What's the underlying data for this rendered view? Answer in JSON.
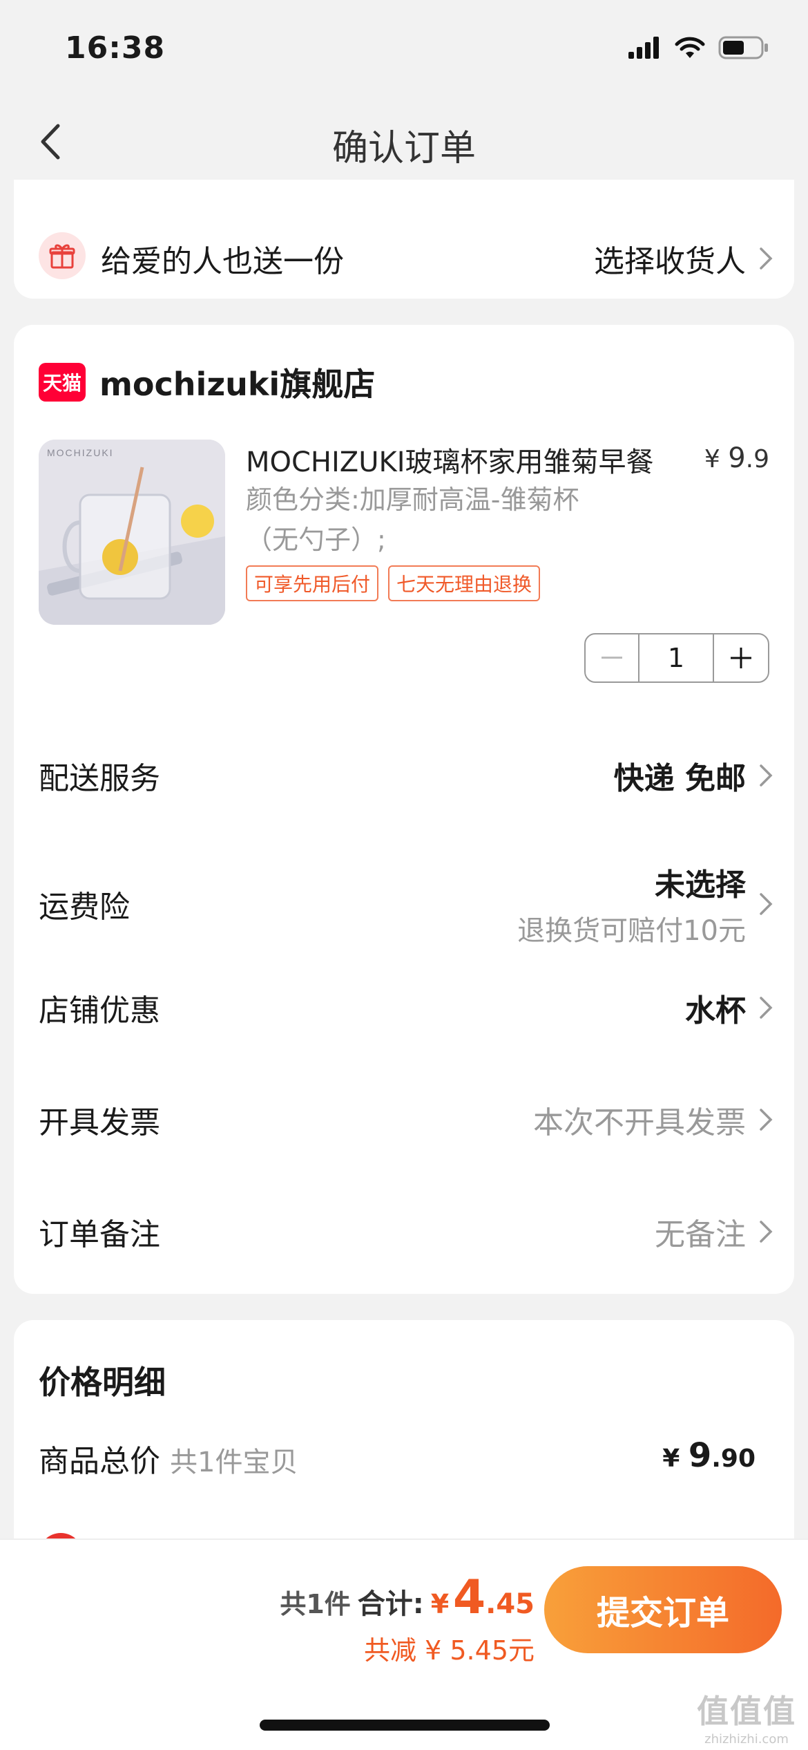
{
  "status_bar": {
    "time": "16:38"
  },
  "nav": {
    "title": "确认订单"
  },
  "gift": {
    "label": "给爱的人也送一份",
    "action": "选择收货人"
  },
  "shop": {
    "logo_text": "天猫",
    "name": "mochizuki旗舰店"
  },
  "product": {
    "image_brand": "MOCHIZUKI",
    "title": "MOCHIZUKI玻璃杯家用雏菊早餐",
    "price_symbol": "¥",
    "price_int": "9",
    "price_dec": ".9",
    "spec_line1": "颜色分类:加厚耐高温-雏菊杯",
    "spec_line2": "（无勺子）;",
    "tags": [
      "可享先用后付",
      "七天无理由退换"
    ],
    "quantity": "1"
  },
  "rows": {
    "delivery": {
      "label": "配送服务",
      "value": "快递 免邮"
    },
    "insurance": {
      "label": "运费险",
      "value": "未选择",
      "sub": "退换货可赔付10元"
    },
    "shop_discount": {
      "label": "店铺优惠",
      "value": "水杯"
    },
    "invoice": {
      "label": "开具发票",
      "value": "本次不开具发票"
    },
    "note": {
      "label": "订单备注",
      "value": "无备注"
    }
  },
  "price_detail": {
    "heading": "价格明细",
    "total_label": "商品总价",
    "total_sub": "共1件宝贝",
    "total_symbol": "¥",
    "total_int": "9",
    "total_dec": ".90"
  },
  "bottom": {
    "count": "共1件",
    "total_label": "合计:",
    "symbol": "¥",
    "amount_int": "4",
    "amount_dec": ".45",
    "saved": "共减 ¥ 5.45元",
    "submit": "提交订单"
  },
  "watermark": {
    "logo": "值值值",
    "text": "zhizhizhi.com"
  },
  "colors": {
    "accent": "#f05a22",
    "tmall_red": "#ff0036",
    "button_start": "#f8a03a",
    "button_end": "#f46a2a"
  }
}
